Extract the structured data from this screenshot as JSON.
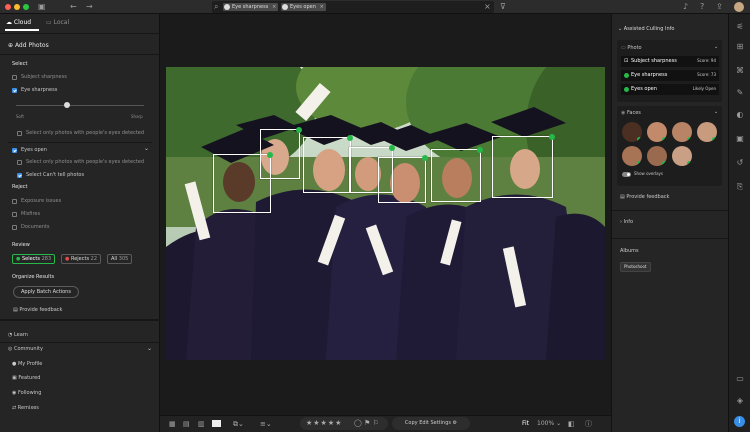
{
  "search": {
    "chips": [
      "Eye sharpness",
      "Eyes open"
    ]
  },
  "left": {
    "tabs": [
      "Cloud",
      "Local"
    ],
    "add_photos": "Add Photos",
    "select_header": "Select",
    "subject_sharpness": "Subject sharpness",
    "eye_sharpness": "Eye sharpness",
    "slider_soft": "Soft",
    "slider_sharp": "Sharp",
    "slider_value": 0.4,
    "only_eyes_detected_1": "Select only photos with people's eyes detected",
    "eyes_open": "Eyes open",
    "only_eyes_detected_2": "Select only photos with people's eyes detected",
    "cant_tell": "Select Can't tell photos",
    "reject_header": "Reject",
    "exposure": "Exposure issues",
    "misfires": "Misfires",
    "documents": "Documents",
    "review_header": "Review",
    "review": {
      "selects": "Selects",
      "selects_count": "283",
      "rejects": "Rejects",
      "rejects_count": "22",
      "all": "All",
      "all_count": "305"
    },
    "organize_header": "Organize Results",
    "batch_btn": "Apply Batch Actions",
    "feedback": "Provide feedback",
    "learn": "Learn",
    "community": "Community",
    "my_profile": "My Profile",
    "featured": "Featured",
    "following": "Following",
    "remixes": "Remixes"
  },
  "bottom": {
    "copy_edit": "Copy Edit Settings",
    "fit": "Fit",
    "zoom": "100%"
  },
  "right": {
    "title": "Assisted Culling Info",
    "photo": "Photo",
    "rows": [
      {
        "label": "Subject sharpness",
        "value": "Score: 94"
      },
      {
        "label": "Eye sharpness",
        "value": "Score: 73"
      },
      {
        "label": "Eyes open",
        "value": "Likely Open"
      }
    ],
    "faces": "Faces",
    "show_overlays": "Show overlays",
    "feedback": "Provide feedback",
    "info": "Info",
    "albums": "Albums",
    "photoshoot": "Photoshoot"
  },
  "colors": {
    "accent": "#3a8ee6",
    "ok": "#27b84a"
  }
}
